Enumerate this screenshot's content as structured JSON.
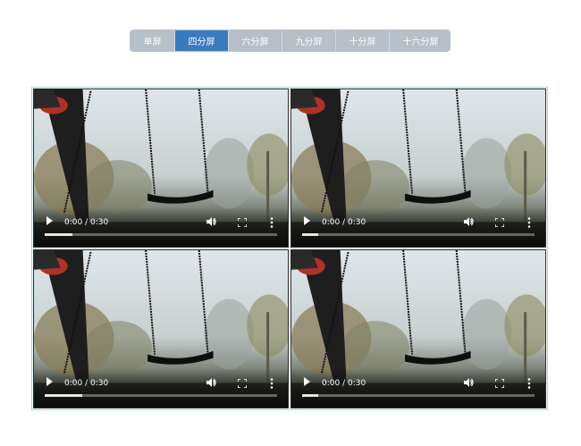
{
  "layout_tabs": {
    "items": [
      {
        "label": "单屏",
        "active": false
      },
      {
        "label": "四分屏",
        "active": true
      },
      {
        "label": "六分屏",
        "active": false
      },
      {
        "label": "九分屏",
        "active": false
      },
      {
        "label": "十分屏",
        "active": false
      },
      {
        "label": "十六分屏",
        "active": false
      }
    ]
  },
  "players": [
    {
      "current_time": "0:00",
      "separator": "/",
      "duration": "0:30",
      "progress": 0.12
    },
    {
      "current_time": "0:00",
      "separator": "/",
      "duration": "0:30",
      "progress": 0.07
    },
    {
      "current_time": "0:00",
      "separator": "/",
      "duration": "0:30",
      "progress": 0.16
    },
    {
      "current_time": "0:00",
      "separator": "/",
      "duration": "0:30",
      "progress": 0.07
    }
  ],
  "icons": {
    "play": "play-icon",
    "volume": "volume-icon",
    "fullscreen": "fullscreen-icon",
    "more": "more-vertical-icon"
  },
  "colors": {
    "tab_active": "#3a7bbf",
    "tab_inactive": "#b7bfc9",
    "grid_border": "#7fe3ea"
  }
}
